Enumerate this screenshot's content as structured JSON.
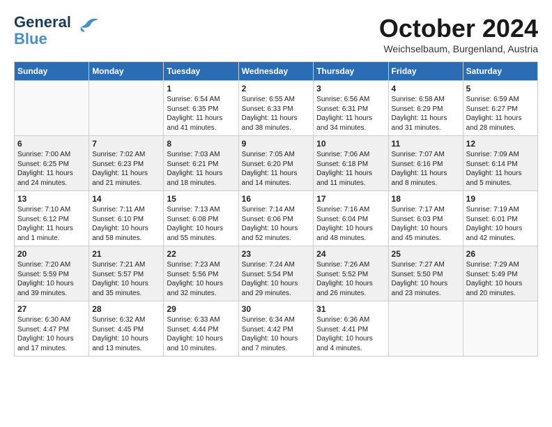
{
  "header": {
    "logo_line1": "General",
    "logo_line2": "Blue",
    "month": "October 2024",
    "location": "Weichselbaum, Burgenland, Austria"
  },
  "weekdays": [
    "Sunday",
    "Monday",
    "Tuesday",
    "Wednesday",
    "Thursday",
    "Friday",
    "Saturday"
  ],
  "weeks": [
    [
      {
        "day": "",
        "info": ""
      },
      {
        "day": "",
        "info": ""
      },
      {
        "day": "1",
        "info": "Sunrise: 6:54 AM\nSunset: 6:35 PM\nDaylight: 11 hours and 41 minutes."
      },
      {
        "day": "2",
        "info": "Sunrise: 6:55 AM\nSunset: 6:33 PM\nDaylight: 11 hours and 38 minutes."
      },
      {
        "day": "3",
        "info": "Sunrise: 6:56 AM\nSunset: 6:31 PM\nDaylight: 11 hours and 34 minutes."
      },
      {
        "day": "4",
        "info": "Sunrise: 6:58 AM\nSunset: 6:29 PM\nDaylight: 11 hours and 31 minutes."
      },
      {
        "day": "5",
        "info": "Sunrise: 6:59 AM\nSunset: 6:27 PM\nDaylight: 11 hours and 28 minutes."
      }
    ],
    [
      {
        "day": "6",
        "info": "Sunrise: 7:00 AM\nSunset: 6:25 PM\nDaylight: 11 hours and 24 minutes."
      },
      {
        "day": "7",
        "info": "Sunrise: 7:02 AM\nSunset: 6:23 PM\nDaylight: 11 hours and 21 minutes."
      },
      {
        "day": "8",
        "info": "Sunrise: 7:03 AM\nSunset: 6:21 PM\nDaylight: 11 hours and 18 minutes."
      },
      {
        "day": "9",
        "info": "Sunrise: 7:05 AM\nSunset: 6:20 PM\nDaylight: 11 hours and 14 minutes."
      },
      {
        "day": "10",
        "info": "Sunrise: 7:06 AM\nSunset: 6:18 PM\nDaylight: 11 hours and 11 minutes."
      },
      {
        "day": "11",
        "info": "Sunrise: 7:07 AM\nSunset: 6:16 PM\nDaylight: 11 hours and 8 minutes."
      },
      {
        "day": "12",
        "info": "Sunrise: 7:09 AM\nSunset: 6:14 PM\nDaylight: 11 hours and 5 minutes."
      }
    ],
    [
      {
        "day": "13",
        "info": "Sunrise: 7:10 AM\nSunset: 6:12 PM\nDaylight: 11 hours and 1 minute."
      },
      {
        "day": "14",
        "info": "Sunrise: 7:11 AM\nSunset: 6:10 PM\nDaylight: 10 hours and 58 minutes."
      },
      {
        "day": "15",
        "info": "Sunrise: 7:13 AM\nSunset: 6:08 PM\nDaylight: 10 hours and 55 minutes."
      },
      {
        "day": "16",
        "info": "Sunrise: 7:14 AM\nSunset: 6:06 PM\nDaylight: 10 hours and 52 minutes."
      },
      {
        "day": "17",
        "info": "Sunrise: 7:16 AM\nSunset: 6:04 PM\nDaylight: 10 hours and 48 minutes."
      },
      {
        "day": "18",
        "info": "Sunrise: 7:17 AM\nSunset: 6:03 PM\nDaylight: 10 hours and 45 minutes."
      },
      {
        "day": "19",
        "info": "Sunrise: 7:19 AM\nSunset: 6:01 PM\nDaylight: 10 hours and 42 minutes."
      }
    ],
    [
      {
        "day": "20",
        "info": "Sunrise: 7:20 AM\nSunset: 5:59 PM\nDaylight: 10 hours and 39 minutes."
      },
      {
        "day": "21",
        "info": "Sunrise: 7:21 AM\nSunset: 5:57 PM\nDaylight: 10 hours and 35 minutes."
      },
      {
        "day": "22",
        "info": "Sunrise: 7:23 AM\nSunset: 5:56 PM\nDaylight: 10 hours and 32 minutes."
      },
      {
        "day": "23",
        "info": "Sunrise: 7:24 AM\nSunset: 5:54 PM\nDaylight: 10 hours and 29 minutes."
      },
      {
        "day": "24",
        "info": "Sunrise: 7:26 AM\nSunset: 5:52 PM\nDaylight: 10 hours and 26 minutes."
      },
      {
        "day": "25",
        "info": "Sunrise: 7:27 AM\nSunset: 5:50 PM\nDaylight: 10 hours and 23 minutes."
      },
      {
        "day": "26",
        "info": "Sunrise: 7:29 AM\nSunset: 5:49 PM\nDaylight: 10 hours and 20 minutes."
      }
    ],
    [
      {
        "day": "27",
        "info": "Sunrise: 6:30 AM\nSunset: 4:47 PM\nDaylight: 10 hours and 17 minutes."
      },
      {
        "day": "28",
        "info": "Sunrise: 6:32 AM\nSunset: 4:45 PM\nDaylight: 10 hours and 13 minutes."
      },
      {
        "day": "29",
        "info": "Sunrise: 6:33 AM\nSunset: 4:44 PM\nDaylight: 10 hours and 10 minutes."
      },
      {
        "day": "30",
        "info": "Sunrise: 6:34 AM\nSunset: 4:42 PM\nDaylight: 10 hours and 7 minutes."
      },
      {
        "day": "31",
        "info": "Sunrise: 6:36 AM\nSunset: 4:41 PM\nDaylight: 10 hours and 4 minutes."
      },
      {
        "day": "",
        "info": ""
      },
      {
        "day": "",
        "info": ""
      }
    ]
  ]
}
